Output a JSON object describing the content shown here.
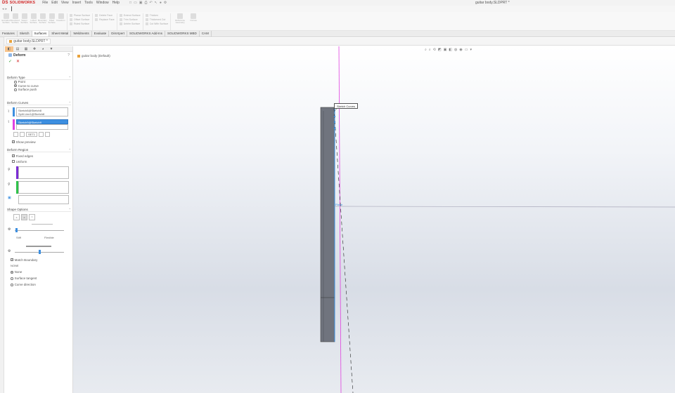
{
  "app": {
    "logo_text": "SOLIDWORKS",
    "logo_mark": "DS",
    "menus": [
      "File",
      "Edit",
      "View",
      "Insert",
      "Tools",
      "Window",
      "Help"
    ],
    "document_title": "guitar body.SLDPRT *"
  },
  "ribbon": {
    "buttons": [
      {
        "label": "Extruded Surface",
        "icon": "extruded-surface-icon"
      },
      {
        "label": "Revolved Surface",
        "icon": "revolved-surface-icon"
      },
      {
        "label": "Swept Surface",
        "icon": "swept-surface-icon"
      },
      {
        "label": "Lofted Surface",
        "icon": "lofted-surface-icon"
      },
      {
        "label": "Boundary Surface",
        "icon": "boundary-surface-icon"
      },
      {
        "label": "Filled Surface",
        "icon": "filled-surface-icon"
      },
      {
        "label": "Freeform",
        "icon": "freeform-icon"
      }
    ],
    "col1": [
      "Planar Surface",
      "Offset Surface",
      "Ruled Surface"
    ],
    "col2": [
      "Delete Face",
      "Replace Face"
    ],
    "col3": [
      "Extend Surface",
      "Trim Surface",
      "Untrim Surface"
    ],
    "col4": [
      "Thicken",
      "Thickened Cut",
      "Cut With Surface"
    ],
    "extra": [
      "Reference Geometry",
      "Curves"
    ]
  },
  "tabs": [
    "Features",
    "Sketch",
    "Surfaces",
    "Sheet Metal",
    "Weldments",
    "Evaluate",
    "DimXpert",
    "SOLIDWORKS Add-Ins",
    "SOLIDWORKS MBD",
    "CAM"
  ],
  "active_tab": "Surfaces",
  "doc_tab": {
    "label": "guitar body.SLDPRT *"
  },
  "property_manager": {
    "title": "Deform",
    "help": "?",
    "ok": "✓",
    "cancel": "✕",
    "deform_type": {
      "title": "Deform Type",
      "options": [
        "Point",
        "Curve to curve",
        "Surface push"
      ],
      "selected": 1
    },
    "deform_curves": {
      "title": "Deform Curves",
      "initial_list": [
        "Sketch8@Sketch8",
        "Split Line1@Sketch8"
      ],
      "target_list": [
        "Sketch9@Sketch9"
      ],
      "small_btns": [
        "SET1"
      ],
      "show_preview": "Show preview"
    },
    "deform_region": {
      "title": "Deform Region",
      "fixed_edges": "Fixed edges",
      "uniform": "Uniform"
    },
    "shape_options": {
      "title": "Shape Options",
      "stiff_left": "Stiff",
      "stiff_right": "Flexible",
      "match_boundary": "Match Boundary",
      "none_label": "NONE",
      "radios": [
        "None",
        "Surface tangent",
        "Curve direction"
      ],
      "selected": 0
    }
  },
  "graphics": {
    "breadcrumb": "guitar body (Default)",
    "callout": "Sketch Curves",
    "axis_label": "Plane"
  },
  "colors": {
    "accent_orange": "#f7c48d",
    "selection_blue": "#3d8fe0",
    "magenta_curve": "#e040e0",
    "purple_swatch": "#7a2bd4",
    "green_swatch": "#2ec24a",
    "body_gray": "#70747e"
  }
}
